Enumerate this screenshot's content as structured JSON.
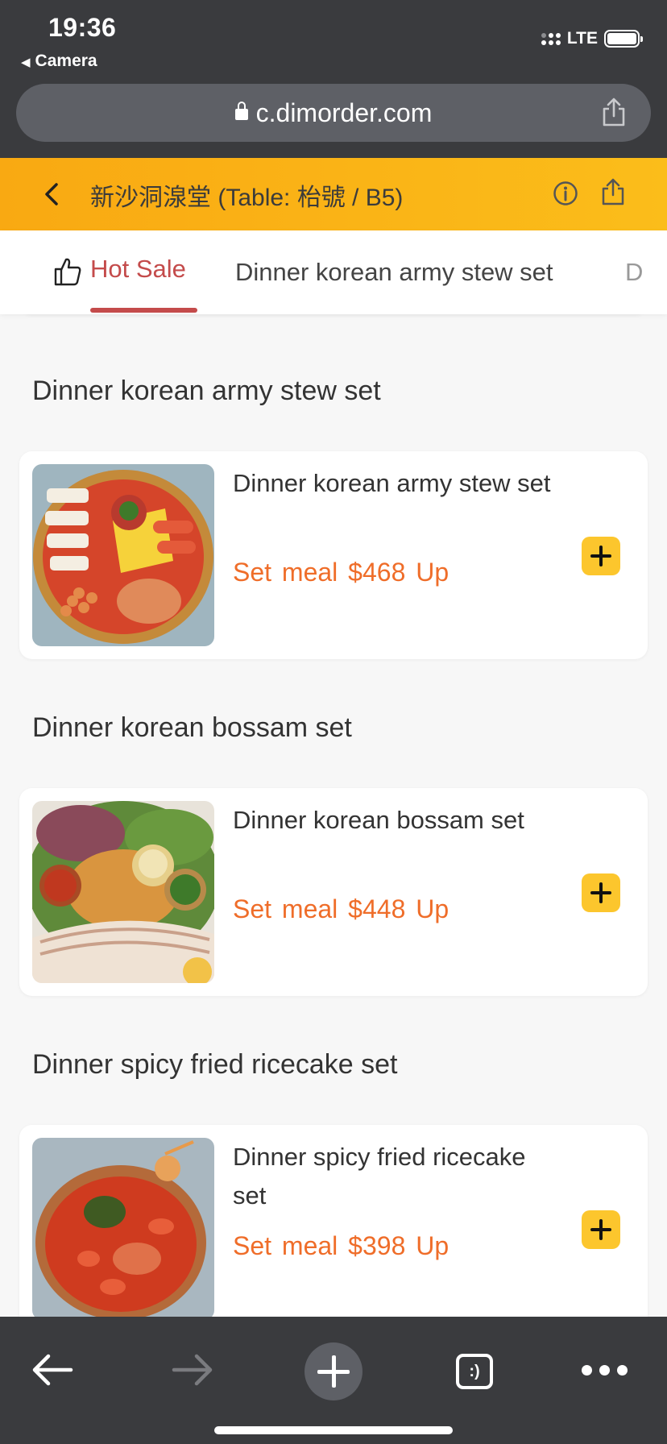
{
  "status_bar": {
    "time": "19:36",
    "back_app": "Camera",
    "network": "LTE"
  },
  "browser": {
    "url": "c.dimorder.com"
  },
  "restaurant": {
    "title": "新沙洞湶堂 (Table: 枱號 / B5)"
  },
  "tabs": [
    {
      "label": "Hot Sale",
      "active": true,
      "icon": "thumbs-up-icon"
    },
    {
      "label": "Dinner korean army stew set",
      "active": false
    },
    {
      "label": "D",
      "active": false
    }
  ],
  "sections": [
    {
      "heading": "Dinner korean army stew set",
      "item": {
        "name": "Dinner korean army stew set",
        "price_prefix": "Set meal",
        "price": "$468",
        "price_suffix": "Up"
      }
    },
    {
      "heading": "Dinner korean bossam set",
      "item": {
        "name": "Dinner korean bossam set",
        "price_prefix": "Set meal",
        "price": "$448",
        "price_suffix": "Up"
      }
    },
    {
      "heading": "Dinner spicy fried ricecake set",
      "item": {
        "name": "Dinner spicy fried ricecake set",
        "price_prefix": "Set meal",
        "price": "$398",
        "price_suffix": "Up"
      }
    }
  ],
  "toolbar": {
    "tabs_glyph": ":)"
  },
  "colors": {
    "accent": "#fbb514",
    "tab_active": "#c44b4b",
    "price": "#ef6d29",
    "add_button": "#fcc62d",
    "chrome": "#3a3b3e"
  }
}
